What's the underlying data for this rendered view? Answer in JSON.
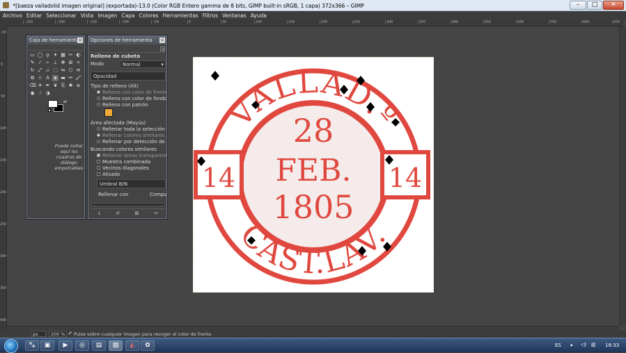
{
  "window": {
    "title": "*[baeza valladolid imagen original] (exportada)-13.0 (Color RGB Entero gamma de 8 bits, GIMP built-in sRGB, 1 capa) 372x366 – GIMP",
    "minimize": "–",
    "maximize": "□",
    "close": "✕"
  },
  "menu": [
    "Archivo",
    "Editar",
    "Seleccionar",
    "Vista",
    "Imagen",
    "Capa",
    "Colores",
    "Herramientas",
    "Filtros",
    "Ventanas",
    "Ayuda"
  ],
  "ruler": {
    "h_ticks": [
      "|-250",
      "|-200",
      "|-150",
      "|-100",
      "|-50",
      "|0",
      "|50",
      "|100",
      "|150",
      "|200",
      "|250",
      "|300",
      "|350",
      "|400",
      "|450",
      "|500",
      "|550",
      "|600",
      "|650"
    ],
    "v_ticks": [
      "-50",
      "0",
      "50",
      "100",
      "150",
      "200",
      "250",
      "300",
      "350",
      "400"
    ]
  },
  "toolbox": {
    "title": "Caja de herramientas",
    "drop_hint": "Puede soltar aquí los cuadros de diálogo empotrables"
  },
  "tool_options": {
    "title": "Opciones de herramienta",
    "tool_name": "Relleno de cubeta",
    "mode_label": "Modo",
    "mode_value": "Normal",
    "opacity_label": "Opacidad",
    "fill_type_label": "Tipo de relleno  (Alt)",
    "fill_fg": "Relleno con color de frente",
    "fill_bg": "Relleno con color de fondo",
    "fill_pattern": "Relleno con patrón",
    "area_label": "Área afectada  (Mayús)",
    "area_selection": "Rellenar toda la selección",
    "area_similar": "Rellenar colores similares",
    "area_line": "Rellenar por detección de línea",
    "similar_label": "Buscando colores similares",
    "transparent": "Rellenar áreas transparentes",
    "sample_merged": "Muestra combinada",
    "diagonal": "Vecinos diagonales",
    "antialias": "Alisado",
    "threshold_label": "Umbral",
    "threshold_value": "B/N",
    "fill_by_label": "Rellenar con",
    "fill_by_value": "Compuesto"
  },
  "stamp": {
    "top_text": "VALLAD.º",
    "bottom_text": "CAST.LAV.",
    "day": "28",
    "month": "FEB.",
    "year": "1805",
    "left_number": "14",
    "right_number": "14",
    "ink_color": "#e0483f"
  },
  "status": {
    "unit": "px",
    "zoom": "200 %",
    "message": "Pulse sobre cualquier imagen para recoger el color de frente"
  },
  "taskbar": {
    "language": "ES",
    "time": "18:33"
  }
}
